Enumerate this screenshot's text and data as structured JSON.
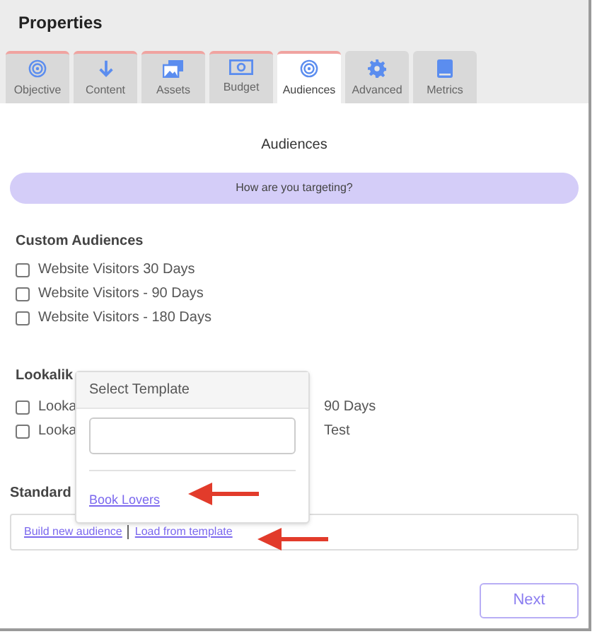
{
  "window": {
    "title": "Properties"
  },
  "tabs": [
    {
      "label": "Objective",
      "kind": "target",
      "selected": false,
      "complete": true
    },
    {
      "label": "Content",
      "kind": "down",
      "selected": false,
      "complete": true
    },
    {
      "label": "Assets",
      "kind": "images",
      "selected": false,
      "complete": true
    },
    {
      "label": "Budget",
      "kind": "money",
      "selected": false,
      "complete": true
    },
    {
      "label": "Audiences",
      "kind": "target",
      "selected": true,
      "complete": true
    },
    {
      "label": "Advanced",
      "kind": "gear",
      "selected": false,
      "complete": false
    },
    {
      "label": "Metrics",
      "kind": "book",
      "selected": false,
      "complete": false
    }
  ],
  "section_title": "Audiences",
  "targeting_banner": "How are you targeting?",
  "custom_audiences": {
    "heading": "Custom Audiences",
    "items": [
      {
        "label": "Website Visitors 30 Days",
        "checked": false
      },
      {
        "label": "Website Visitors - 90 Days",
        "checked": false
      },
      {
        "label": "Website Visitors - 180 Days",
        "checked": false
      }
    ]
  },
  "lookalike": {
    "heading": "Lookalik",
    "items": [
      {
        "start": "Looka",
        "end": "90 Days",
        "checked": false
      },
      {
        "start": "Looka",
        "end": "Test",
        "checked": false
      }
    ]
  },
  "standard": {
    "heading": "Standard",
    "links": [
      "Build new audience",
      "Load from template"
    ]
  },
  "popover": {
    "title": "Select Template",
    "templates": [
      "Book Lovers"
    ]
  },
  "next_button": "Next"
}
